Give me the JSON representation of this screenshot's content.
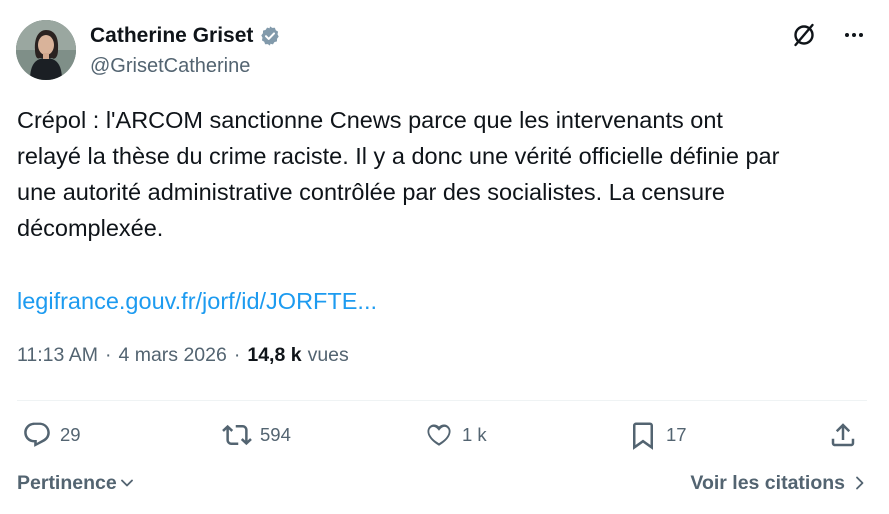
{
  "author": {
    "display_name": "Catherine Griset",
    "handle": "@GrisetCatherine",
    "verified": true
  },
  "icons": {
    "avatar": "profile-photo",
    "verified": "verified-badge-icon",
    "grok": "grok-icon",
    "more": "more-options-icon",
    "reply": "reply-icon",
    "retweet": "retweet-icon",
    "like": "heart-icon",
    "bookmark": "bookmark-icon",
    "share": "share-icon"
  },
  "tweet": {
    "text": "Crépol : l'ARCOM sanctionne Cnews parce que les intervenants ont\nrelayé la thèse du crime raciste. Il y a donc une vérité officielle définie par\nune autorité administrative contrôlée par des socialistes. La censure\ndécomplexée.",
    "link": "legifrance.gouv.fr/jorf/id/JORFTE..."
  },
  "meta": {
    "time": "11:13 AM",
    "separator": "·",
    "date": "4 mars 2026",
    "views_count": "14,8 k",
    "views_label": "vues"
  },
  "actions": {
    "replies": "29",
    "retweets": "594",
    "likes": "1 k",
    "bookmarks": "17"
  },
  "footer": {
    "sort_label": "Pertinence",
    "quotes_label": "Voir les citations"
  },
  "colors": {
    "text": "#0f1419",
    "secondary": "#536471",
    "link": "#1d9bf0",
    "verified": "#829aab",
    "divider": "#eff3f4"
  }
}
